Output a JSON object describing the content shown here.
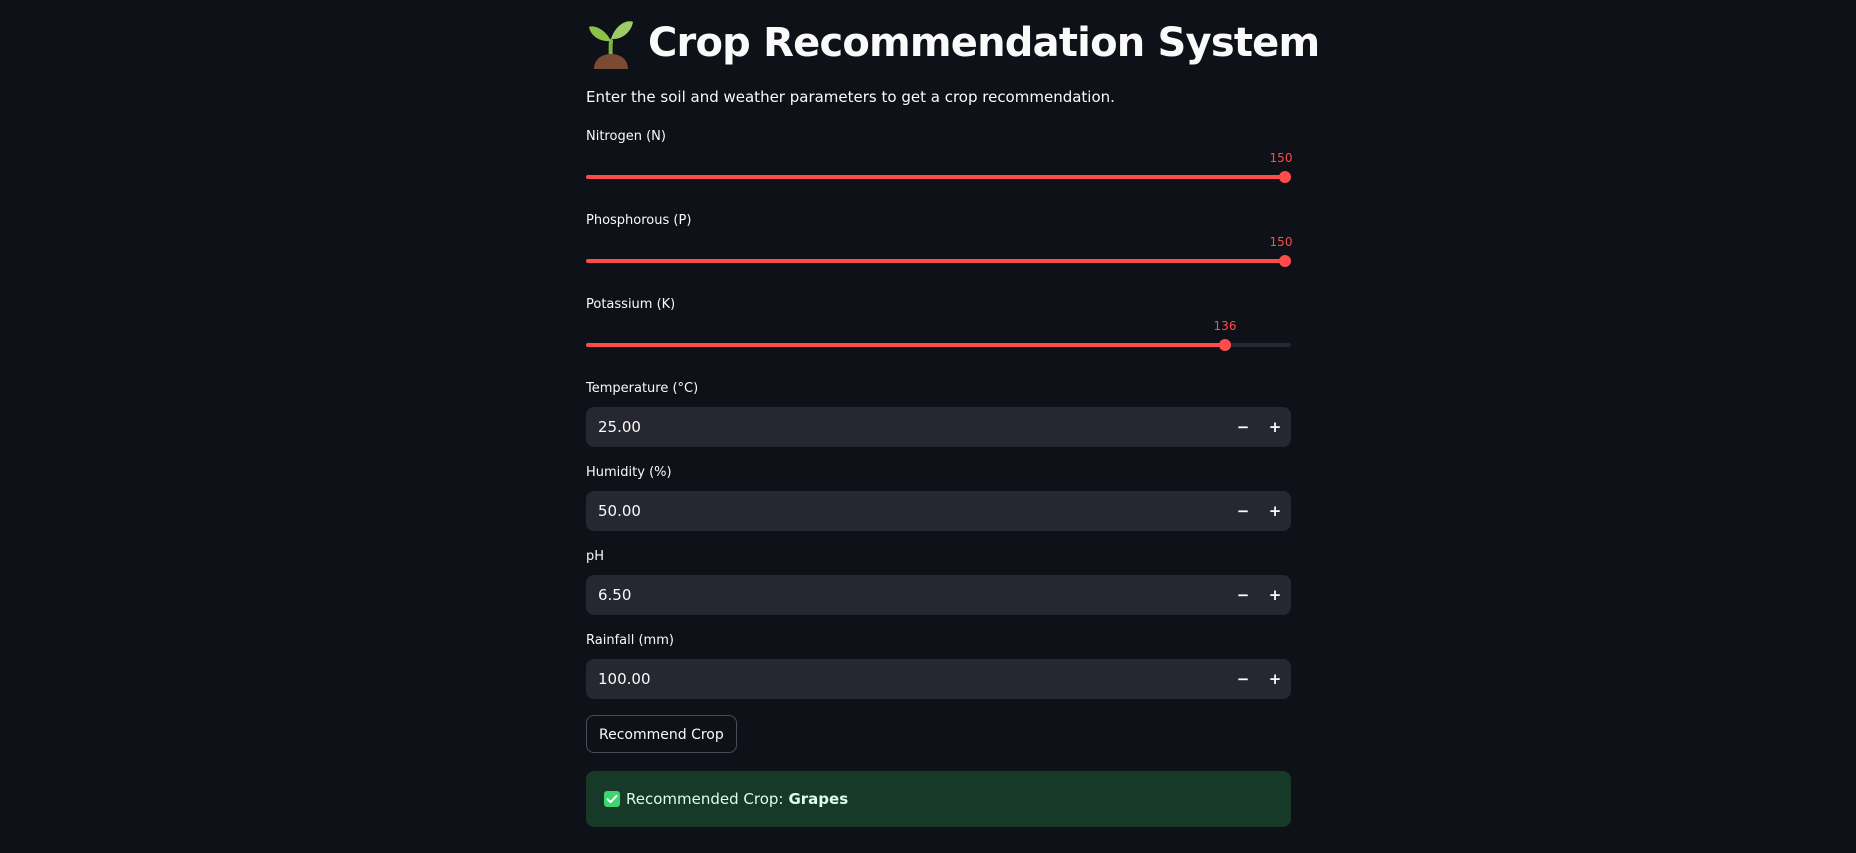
{
  "header": {
    "title": "Crop Recommendation System",
    "title_icon": "seedling-icon",
    "intro": "Enter the soil and weather parameters to get a crop recommendation."
  },
  "sliders": [
    {
      "label": "Nitrogen (N)",
      "value": 150,
      "value_label": "150",
      "fraction": 1.0
    },
    {
      "label": "Phosphorous (P)",
      "value": 150,
      "value_label": "150",
      "fraction": 1.0
    },
    {
      "label": "Potassium (K)",
      "value": 136,
      "value_label": "136",
      "fraction": 0.907
    }
  ],
  "number_inputs": [
    {
      "label": "Temperature (°C)",
      "value": "25.00",
      "minus": "−",
      "plus": "+"
    },
    {
      "label": "Humidity (%)",
      "value": "50.00",
      "minus": "−",
      "plus": "+"
    },
    {
      "label": "pH",
      "value": "6.50",
      "minus": "−",
      "plus": "+"
    },
    {
      "label": "Rainfall (mm)",
      "value": "100.00",
      "minus": "−",
      "plus": "+"
    }
  ],
  "action": {
    "button_label": "Recommend Crop"
  },
  "result": {
    "icon": "check-box-icon",
    "prefix": "Recommended Crop:",
    "crop": "Grapes"
  },
  "colors": {
    "background": "#0e1117",
    "accent": "#ff4b4b",
    "input_background": "#262730",
    "success_background": "#173928"
  }
}
